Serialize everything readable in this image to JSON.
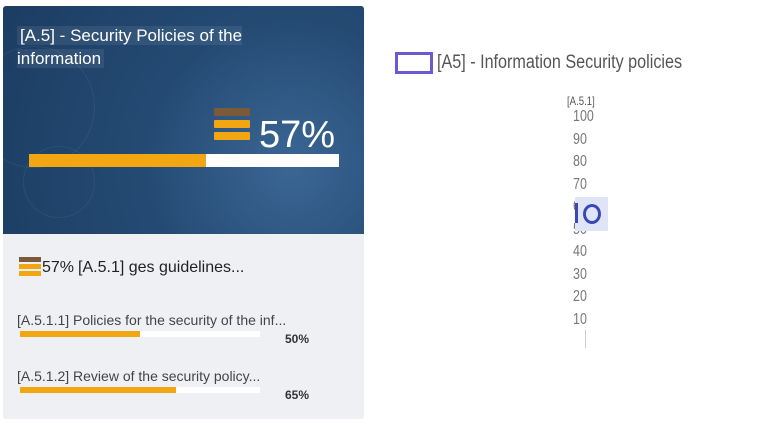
{
  "card": {
    "title": "[A.5] - Security Policies of the information",
    "percent_label": "57%",
    "progress": 0.57,
    "accent_color": "#f2a612",
    "header_bg": "#244a73",
    "subhead": {
      "percent_label": "57%",
      "text": "[A.5.1] ges guidelines..."
    },
    "items": [
      {
        "label": "[A.5.1.1] Policies for the security of the inf...",
        "percent_label": "50%",
        "progress": 0.5
      },
      {
        "label": "[A.5.1.2] Review of the security policy...",
        "percent_label": "65%",
        "progress": 0.65
      }
    ],
    "icon": "stacked-bars-icon"
  },
  "chart": {
    "legend_label": "[A5] - Information Security policies",
    "legend_color": "#6b5bd3",
    "axis_label": "[A.5.1]",
    "ticks": [
      "100",
      "90",
      "80",
      "70",
      "60",
      "50",
      "40",
      "30",
      "20",
      "10"
    ]
  },
  "chart_data": {
    "type": "bar",
    "title": "",
    "xlabel": "",
    "ylabel": "[A.5.1]",
    "ylim": [
      0,
      100
    ],
    "categories": [
      "[A.5.1]"
    ],
    "series": [
      {
        "name": "[A5] - Information Security policies",
        "values": [
          57
        ]
      }
    ]
  }
}
